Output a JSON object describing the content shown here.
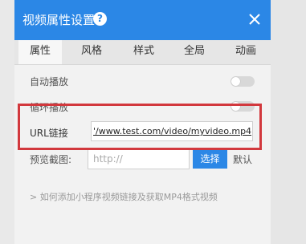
{
  "dialog": {
    "title": "视频属性设置",
    "help_icon": "question-circle-icon",
    "close_icon": "close-x-icon",
    "accent_color": "#2b87e6",
    "highlight_color": "#d2383d"
  },
  "tabs": [
    {
      "label": "属性",
      "active": true
    },
    {
      "label": "风格",
      "active": false
    },
    {
      "label": "样式",
      "active": false
    },
    {
      "label": "全局",
      "active": false
    },
    {
      "label": "动画",
      "active": false
    }
  ],
  "settings": {
    "autoplay": {
      "label": "自动播放",
      "on": false
    },
    "loop": {
      "label": "循环播放",
      "on": false
    },
    "url": {
      "label": "URL链接",
      "value": "'/www.test.com/video/myvideo.mp4"
    },
    "preview": {
      "label": "预览截图:",
      "placeholder": "http://",
      "select_label": "选择",
      "default_label": "默认"
    }
  },
  "help_link": "> 如何添加小程序视频链接及获取MP4格式视频"
}
